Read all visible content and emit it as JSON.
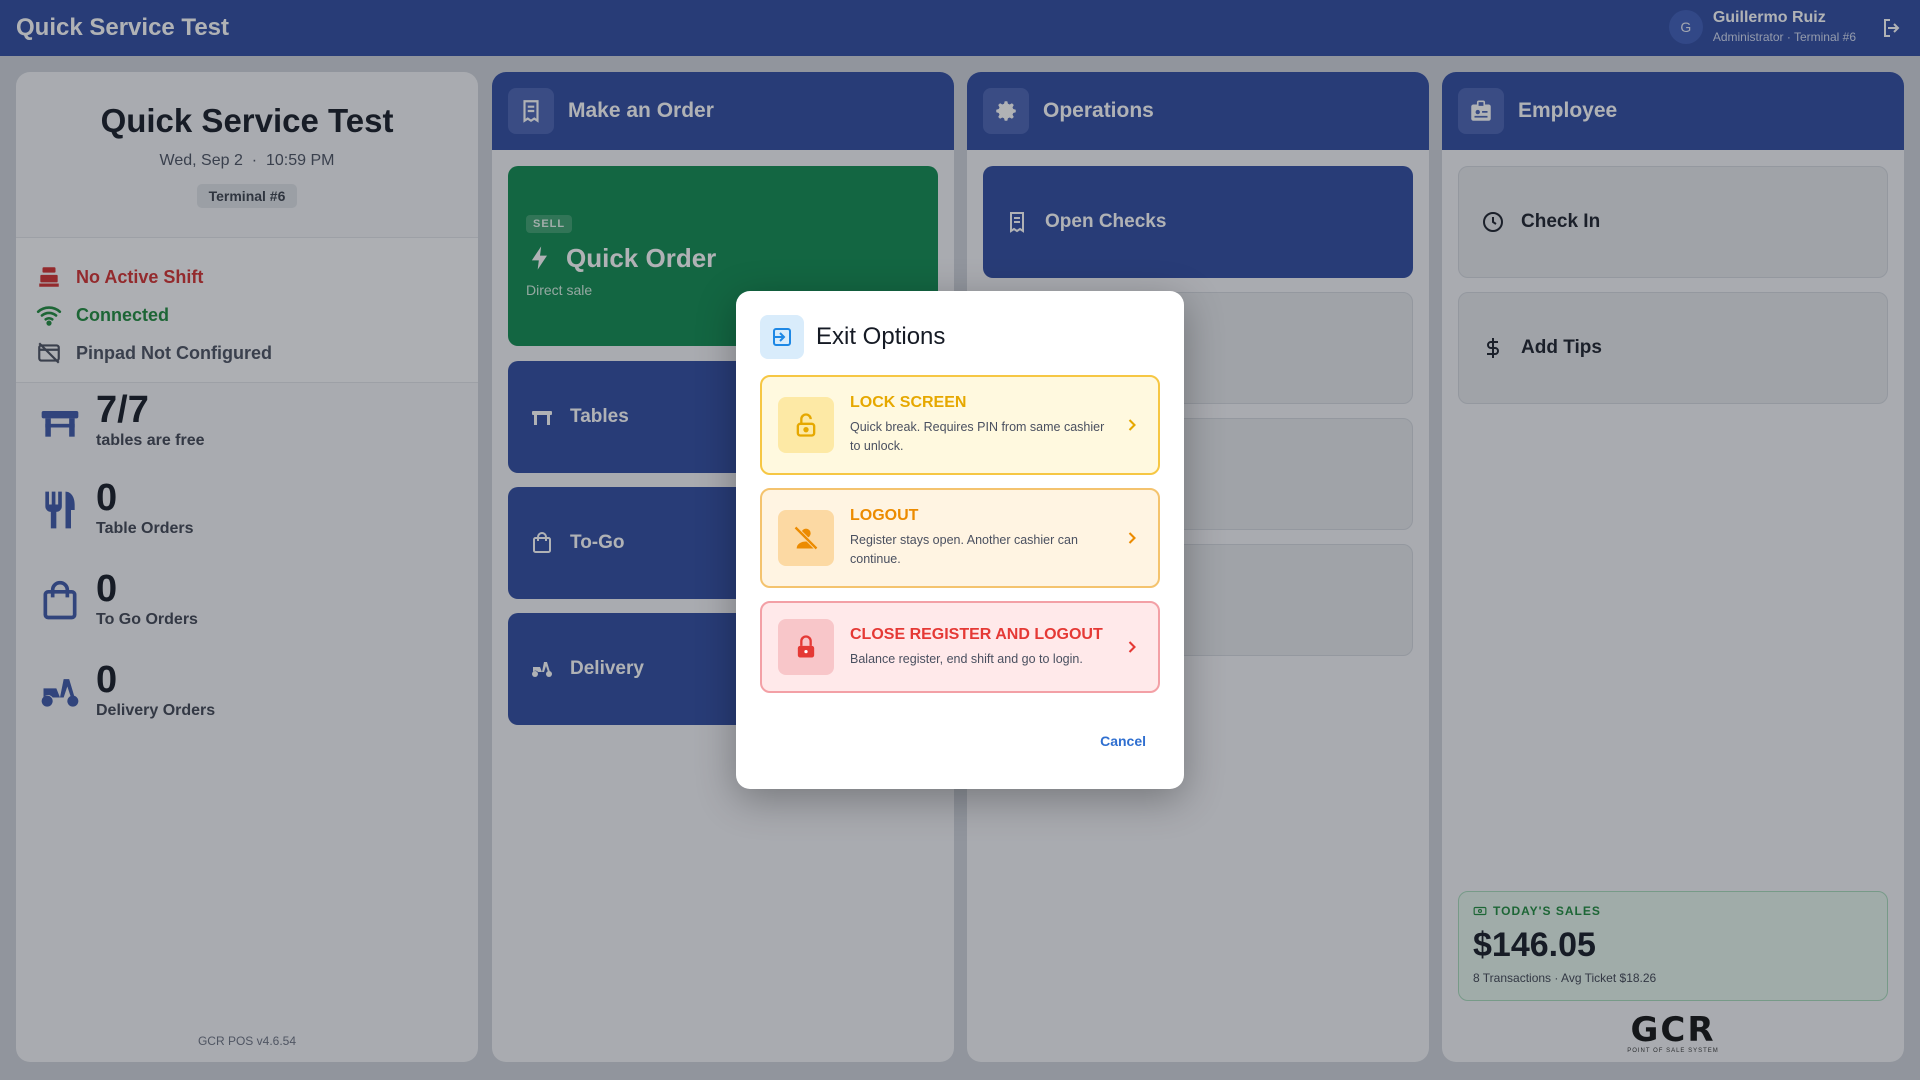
{
  "topbar": {
    "app_title": "Quick Service Test",
    "avatar_initial": "G",
    "user_name": "Guillermo Ruiz",
    "user_role": "Administrator · Terminal #6",
    "exit_icon": "exit-icon"
  },
  "status_panel": {
    "title": "Quick Service Test",
    "date": "Wed, Sep 2",
    "time": "10:59 PM",
    "terminal": "Terminal #6",
    "statuses": [
      {
        "label": "No Active Shift",
        "icon": "register-icon",
        "color": "#d32f2f"
      },
      {
        "label": "Connected",
        "icon": "wifi-icon",
        "color": "#1e8a3c"
      },
      {
        "label": "Pinpad Not Configured",
        "icon": "card-off-icon",
        "color": "#4b5060"
      }
    ],
    "stats": [
      {
        "value": "7/7",
        "label": "tables are free",
        "icon": "table-icon"
      },
      {
        "value": "0",
        "label": "Table Orders",
        "icon": "utensils-icon"
      },
      {
        "value": "0",
        "label": "To Go Orders",
        "icon": "bag-icon"
      },
      {
        "value": "0",
        "label": "Delivery Orders",
        "icon": "scooter-icon"
      }
    ],
    "version": "GCR POS v4.6.54"
  },
  "make_order": {
    "header": "Make an Order",
    "quick_order": {
      "tag": "SELL",
      "label": "Quick Order",
      "subtitle": "Direct sale"
    },
    "tiles": [
      {
        "label": "Tables"
      },
      {
        "label": "To-Go"
      },
      {
        "label": "Delivery"
      }
    ]
  },
  "operations": {
    "header": "Operations",
    "tiles": [
      {
        "label": "Open Checks"
      }
    ]
  },
  "employee": {
    "header": "Employee",
    "tiles": [
      {
        "label": "Check In"
      },
      {
        "label": "Add Tips"
      }
    ],
    "sales": {
      "label": "TODAY'S SALES",
      "value": "$146.05",
      "summary": "8 Transactions · Avg Ticket $18.26"
    },
    "brand": "GCR",
    "brand_sub": "POINT OF SALE SYSTEM"
  },
  "dialog": {
    "title": "Exit Options",
    "options": [
      {
        "title": "LOCK SCREEN",
        "description": "Quick break. Requires PIN from same cashier to unlock."
      },
      {
        "title": "LOGOUT",
        "description": "Register stays open. Another cashier can continue."
      },
      {
        "title": "CLOSE REGISTER AND LOGOUT",
        "description": "Balance register, end shift and go to login."
      }
    ],
    "cancel_label": "Cancel"
  },
  "colors": {
    "brand_blue": "#2f4aa0",
    "sell_green": "#0e8a4f",
    "lock_yellow": "#e6a800",
    "logout_orange": "#ec8b00",
    "close_red": "#e53935"
  }
}
